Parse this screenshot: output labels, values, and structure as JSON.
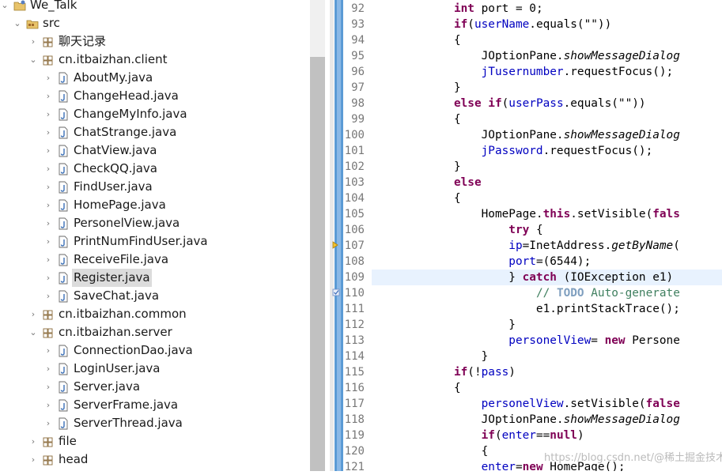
{
  "explorer": {
    "rows": [
      {
        "label": "We_Talk",
        "twisty": "⌄",
        "icon": "project-icon",
        "depth": 0
      },
      {
        "label": "src",
        "twisty": "⌄",
        "icon": "source-folder-icon",
        "depth": 1
      },
      {
        "label": "聊天记录",
        "twisty": "›",
        "icon": "package-icon",
        "depth": 2
      },
      {
        "label": "cn.itbaizhan.client",
        "twisty": "⌄",
        "icon": "package-icon",
        "depth": 2
      },
      {
        "label": "AboutMy.java",
        "twisty": "›",
        "icon": "java-file-icon",
        "depth": 3
      },
      {
        "label": "ChangeHead.java",
        "twisty": "›",
        "icon": "java-file-icon",
        "depth": 3
      },
      {
        "label": "ChangeMyInfo.java",
        "twisty": "›",
        "icon": "java-file-icon",
        "depth": 3
      },
      {
        "label": "ChatStrange.java",
        "twisty": "›",
        "icon": "java-file-icon",
        "depth": 3
      },
      {
        "label": "ChatView.java",
        "twisty": "›",
        "icon": "java-file-icon",
        "depth": 3
      },
      {
        "label": "CheckQQ.java",
        "twisty": "›",
        "icon": "java-file-icon",
        "depth": 3
      },
      {
        "label": "FindUser.java",
        "twisty": "›",
        "icon": "java-file-icon",
        "depth": 3
      },
      {
        "label": "HomePage.java",
        "twisty": "›",
        "icon": "java-file-icon",
        "depth": 3
      },
      {
        "label": "PersonelView.java",
        "twisty": "›",
        "icon": "java-file-icon",
        "depth": 3
      },
      {
        "label": "PrintNumFindUser.java",
        "twisty": "›",
        "icon": "java-file-icon",
        "depth": 3
      },
      {
        "label": "ReceiveFile.java",
        "twisty": "›",
        "icon": "java-file-icon",
        "depth": 3
      },
      {
        "label": "Register.java",
        "twisty": "›",
        "icon": "java-file-icon",
        "depth": 3,
        "selected": true
      },
      {
        "label": "SaveChat.java",
        "twisty": "›",
        "icon": "java-file-icon",
        "depth": 3
      },
      {
        "label": "cn.itbaizhan.common",
        "twisty": "›",
        "icon": "package-icon",
        "depth": 2
      },
      {
        "label": "cn.itbaizhan.server",
        "twisty": "⌄",
        "icon": "package-icon",
        "depth": 2
      },
      {
        "label": "ConnectionDao.java",
        "twisty": "›",
        "icon": "java-file-icon",
        "depth": 3
      },
      {
        "label": "LoginUser.java",
        "twisty": "›",
        "icon": "java-file-icon",
        "depth": 3
      },
      {
        "label": "Server.java",
        "twisty": "›",
        "icon": "java-file-icon",
        "depth": 3
      },
      {
        "label": "ServerFrame.java",
        "twisty": "›",
        "icon": "java-file-icon",
        "depth": 3
      },
      {
        "label": "ServerThread.java",
        "twisty": "›",
        "icon": "java-file-icon",
        "depth": 3
      },
      {
        "label": "file",
        "twisty": "›",
        "icon": "package-icon",
        "depth": 2
      },
      {
        "label": "head",
        "twisty": "›",
        "icon": "package-icon",
        "depth": 2
      }
    ]
  },
  "editor": {
    "lines": [
      {
        "no": "92",
        "tokens": [
          [
            "            ",
            ""
          ],
          [
            "int",
            "kw"
          ],
          [
            " port = 0;",
            ""
          ]
        ]
      },
      {
        "no": "93",
        "tokens": [
          [
            "            ",
            ""
          ],
          [
            "if",
            "kw"
          ],
          [
            "(",
            ""
          ],
          [
            "userName",
            "fld"
          ],
          [
            ".equals(\"\"))",
            ""
          ]
        ]
      },
      {
        "no": "94",
        "tokens": [
          [
            "            {",
            ""
          ]
        ]
      },
      {
        "no": "95",
        "tokens": [
          [
            "                JOptionPane.",
            ""
          ],
          [
            "showMessageDialog",
            "it"
          ]
        ]
      },
      {
        "no": "96",
        "tokens": [
          [
            "                ",
            ""
          ],
          [
            "jTusernumber",
            "fld"
          ],
          [
            ".requestFocus();",
            ""
          ]
        ]
      },
      {
        "no": "97",
        "tokens": [
          [
            "            }",
            ""
          ]
        ]
      },
      {
        "no": "98",
        "tokens": [
          [
            "            ",
            ""
          ],
          [
            "else",
            "kw"
          ],
          [
            " ",
            ""
          ],
          [
            "if",
            "kw"
          ],
          [
            "(",
            ""
          ],
          [
            "userPass",
            "fld"
          ],
          [
            ".equals(\"\"))",
            ""
          ]
        ]
      },
      {
        "no": "99",
        "tokens": [
          [
            "            {",
            ""
          ]
        ]
      },
      {
        "no": "100",
        "tokens": [
          [
            "                JOptionPane.",
            ""
          ],
          [
            "showMessageDialog",
            "it"
          ]
        ]
      },
      {
        "no": "101",
        "tokens": [
          [
            "                ",
            ""
          ],
          [
            "jPassword",
            "fld"
          ],
          [
            ".requestFocus();",
            ""
          ]
        ]
      },
      {
        "no": "102",
        "tokens": [
          [
            "            }",
            ""
          ]
        ]
      },
      {
        "no": "103",
        "tokens": [
          [
            "            ",
            ""
          ],
          [
            "else",
            "kw"
          ]
        ]
      },
      {
        "no": "104",
        "tokens": [
          [
            "            {",
            ""
          ]
        ]
      },
      {
        "no": "105",
        "tokens": [
          [
            "                HomePage.",
            ""
          ],
          [
            "this",
            "kw"
          ],
          [
            ".setVisible(",
            ""
          ],
          [
            "fals",
            "kw"
          ]
        ]
      },
      {
        "no": "106",
        "tokens": [
          [
            "                    ",
            ""
          ],
          [
            "try",
            "kw"
          ],
          [
            " {",
            ""
          ]
        ]
      },
      {
        "no": "107",
        "tokens": [
          [
            "                    ",
            ""
          ],
          [
            "ip",
            "fld"
          ],
          [
            "=InetAddress.",
            ""
          ],
          [
            "getByName",
            "it"
          ],
          [
            "(",
            ""
          ]
        ]
      },
      {
        "no": "108",
        "tokens": [
          [
            "                    ",
            ""
          ],
          [
            "port",
            "fld"
          ],
          [
            "=(6544);",
            ""
          ]
        ]
      },
      {
        "no": "109",
        "tokens": [
          [
            "                    } ",
            ""
          ],
          [
            "catch",
            "kw"
          ],
          [
            " (IOException e1)",
            ""
          ]
        ],
        "current": true
      },
      {
        "no": "110",
        "tokens": [
          [
            "                        ",
            ""
          ],
          [
            "// ",
            "cmt"
          ],
          [
            "TODO",
            "todo"
          ],
          [
            " Auto-generate",
            "cmt"
          ]
        ]
      },
      {
        "no": "111",
        "tokens": [
          [
            "                        e1.printStackTrace();",
            ""
          ]
        ]
      },
      {
        "no": "112",
        "tokens": [
          [
            "                    }",
            ""
          ]
        ]
      },
      {
        "no": "113",
        "tokens": [
          [
            "                    ",
            ""
          ],
          [
            "personelView",
            "fld"
          ],
          [
            "= ",
            ""
          ],
          [
            "new",
            "kw"
          ],
          [
            " Persone",
            ""
          ]
        ]
      },
      {
        "no": "114",
        "tokens": [
          [
            "                }",
            ""
          ]
        ]
      },
      {
        "no": "115",
        "tokens": [
          [
            "            ",
            ""
          ],
          [
            "if",
            "kw"
          ],
          [
            "(!",
            ""
          ],
          [
            "pass",
            "fld"
          ],
          [
            ")",
            ""
          ]
        ]
      },
      {
        "no": "116",
        "tokens": [
          [
            "            {",
            ""
          ]
        ]
      },
      {
        "no": "117",
        "tokens": [
          [
            "                ",
            ""
          ],
          [
            "personelView",
            "fld"
          ],
          [
            ".setVisible(",
            ""
          ],
          [
            "false",
            "kw"
          ]
        ]
      },
      {
        "no": "118",
        "tokens": [
          [
            "                JOptionPane.",
            ""
          ],
          [
            "showMessageDialog",
            "it"
          ]
        ]
      },
      {
        "no": "119",
        "tokens": [
          [
            "                ",
            ""
          ],
          [
            "if",
            "kw"
          ],
          [
            "(",
            ""
          ],
          [
            "enter",
            "fld"
          ],
          [
            "==",
            ""
          ],
          [
            "null",
            "kw"
          ],
          [
            ")",
            ""
          ]
        ]
      },
      {
        "no": "120",
        "tokens": [
          [
            "                {",
            ""
          ]
        ]
      },
      {
        "no": "121",
        "tokens": [
          [
            "                ",
            ""
          ],
          [
            "enter",
            "fld"
          ],
          [
            "=",
            ""
          ],
          [
            "new",
            "kw"
          ],
          [
            " HomePage();",
            ""
          ]
        ]
      }
    ]
  },
  "watermark": "https://blog.csdn.net/@稀土掘金技术社区"
}
